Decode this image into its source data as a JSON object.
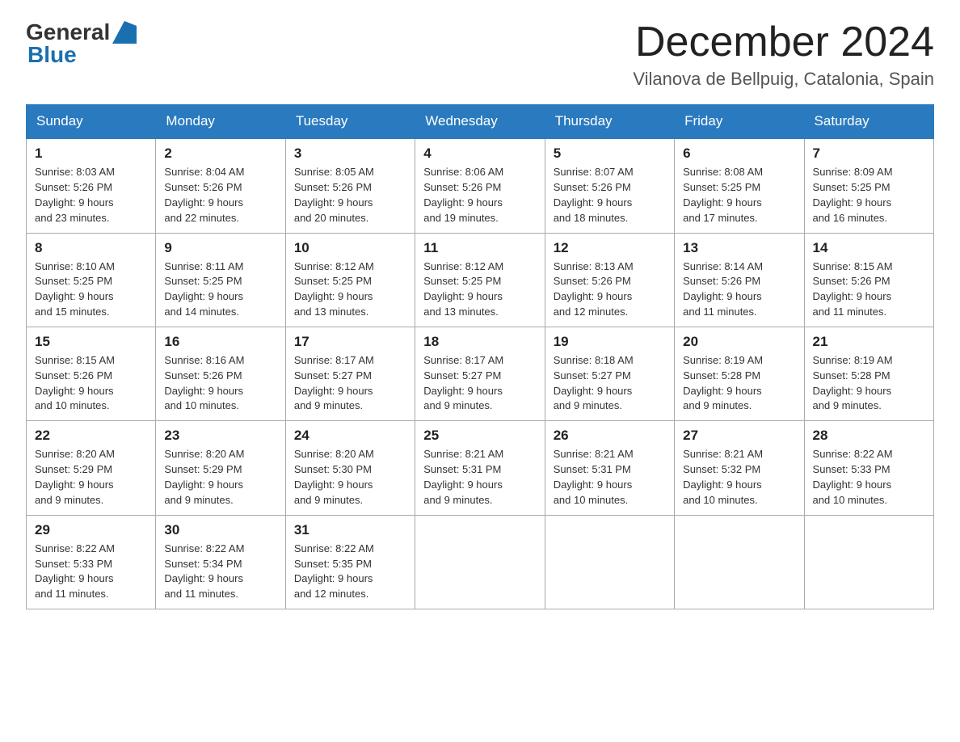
{
  "header": {
    "logo_general": "General",
    "logo_blue": "Blue",
    "month_title": "December 2024",
    "location": "Vilanova de Bellpuig, Catalonia, Spain"
  },
  "weekdays": [
    "Sunday",
    "Monday",
    "Tuesday",
    "Wednesday",
    "Thursday",
    "Friday",
    "Saturday"
  ],
  "weeks": [
    [
      {
        "day": "1",
        "sunrise": "8:03 AM",
        "sunset": "5:26 PM",
        "daylight": "9 hours and 23 minutes."
      },
      {
        "day": "2",
        "sunrise": "8:04 AM",
        "sunset": "5:26 PM",
        "daylight": "9 hours and 22 minutes."
      },
      {
        "day": "3",
        "sunrise": "8:05 AM",
        "sunset": "5:26 PM",
        "daylight": "9 hours and 20 minutes."
      },
      {
        "day": "4",
        "sunrise": "8:06 AM",
        "sunset": "5:26 PM",
        "daylight": "9 hours and 19 minutes."
      },
      {
        "day": "5",
        "sunrise": "8:07 AM",
        "sunset": "5:26 PM",
        "daylight": "9 hours and 18 minutes."
      },
      {
        "day": "6",
        "sunrise": "8:08 AM",
        "sunset": "5:25 PM",
        "daylight": "9 hours and 17 minutes."
      },
      {
        "day": "7",
        "sunrise": "8:09 AM",
        "sunset": "5:25 PM",
        "daylight": "9 hours and 16 minutes."
      }
    ],
    [
      {
        "day": "8",
        "sunrise": "8:10 AM",
        "sunset": "5:25 PM",
        "daylight": "9 hours and 15 minutes."
      },
      {
        "day": "9",
        "sunrise": "8:11 AM",
        "sunset": "5:25 PM",
        "daylight": "9 hours and 14 minutes."
      },
      {
        "day": "10",
        "sunrise": "8:12 AM",
        "sunset": "5:25 PM",
        "daylight": "9 hours and 13 minutes."
      },
      {
        "day": "11",
        "sunrise": "8:12 AM",
        "sunset": "5:25 PM",
        "daylight": "9 hours and 13 minutes."
      },
      {
        "day": "12",
        "sunrise": "8:13 AM",
        "sunset": "5:26 PM",
        "daylight": "9 hours and 12 minutes."
      },
      {
        "day": "13",
        "sunrise": "8:14 AM",
        "sunset": "5:26 PM",
        "daylight": "9 hours and 11 minutes."
      },
      {
        "day": "14",
        "sunrise": "8:15 AM",
        "sunset": "5:26 PM",
        "daylight": "9 hours and 11 minutes."
      }
    ],
    [
      {
        "day": "15",
        "sunrise": "8:15 AM",
        "sunset": "5:26 PM",
        "daylight": "9 hours and 10 minutes."
      },
      {
        "day": "16",
        "sunrise": "8:16 AM",
        "sunset": "5:26 PM",
        "daylight": "9 hours and 10 minutes."
      },
      {
        "day": "17",
        "sunrise": "8:17 AM",
        "sunset": "5:27 PM",
        "daylight": "9 hours and 9 minutes."
      },
      {
        "day": "18",
        "sunrise": "8:17 AM",
        "sunset": "5:27 PM",
        "daylight": "9 hours and 9 minutes."
      },
      {
        "day": "19",
        "sunrise": "8:18 AM",
        "sunset": "5:27 PM",
        "daylight": "9 hours and 9 minutes."
      },
      {
        "day": "20",
        "sunrise": "8:19 AM",
        "sunset": "5:28 PM",
        "daylight": "9 hours and 9 minutes."
      },
      {
        "day": "21",
        "sunrise": "8:19 AM",
        "sunset": "5:28 PM",
        "daylight": "9 hours and 9 minutes."
      }
    ],
    [
      {
        "day": "22",
        "sunrise": "8:20 AM",
        "sunset": "5:29 PM",
        "daylight": "9 hours and 9 minutes."
      },
      {
        "day": "23",
        "sunrise": "8:20 AM",
        "sunset": "5:29 PM",
        "daylight": "9 hours and 9 minutes."
      },
      {
        "day": "24",
        "sunrise": "8:20 AM",
        "sunset": "5:30 PM",
        "daylight": "9 hours and 9 minutes."
      },
      {
        "day": "25",
        "sunrise": "8:21 AM",
        "sunset": "5:31 PM",
        "daylight": "9 hours and 9 minutes."
      },
      {
        "day": "26",
        "sunrise": "8:21 AM",
        "sunset": "5:31 PM",
        "daylight": "9 hours and 10 minutes."
      },
      {
        "day": "27",
        "sunrise": "8:21 AM",
        "sunset": "5:32 PM",
        "daylight": "9 hours and 10 minutes."
      },
      {
        "day": "28",
        "sunrise": "8:22 AM",
        "sunset": "5:33 PM",
        "daylight": "9 hours and 10 minutes."
      }
    ],
    [
      {
        "day": "29",
        "sunrise": "8:22 AM",
        "sunset": "5:33 PM",
        "daylight": "9 hours and 11 minutes."
      },
      {
        "day": "30",
        "sunrise": "8:22 AM",
        "sunset": "5:34 PM",
        "daylight": "9 hours and 11 minutes."
      },
      {
        "day": "31",
        "sunrise": "8:22 AM",
        "sunset": "5:35 PM",
        "daylight": "9 hours and 12 minutes."
      },
      null,
      null,
      null,
      null
    ]
  ]
}
